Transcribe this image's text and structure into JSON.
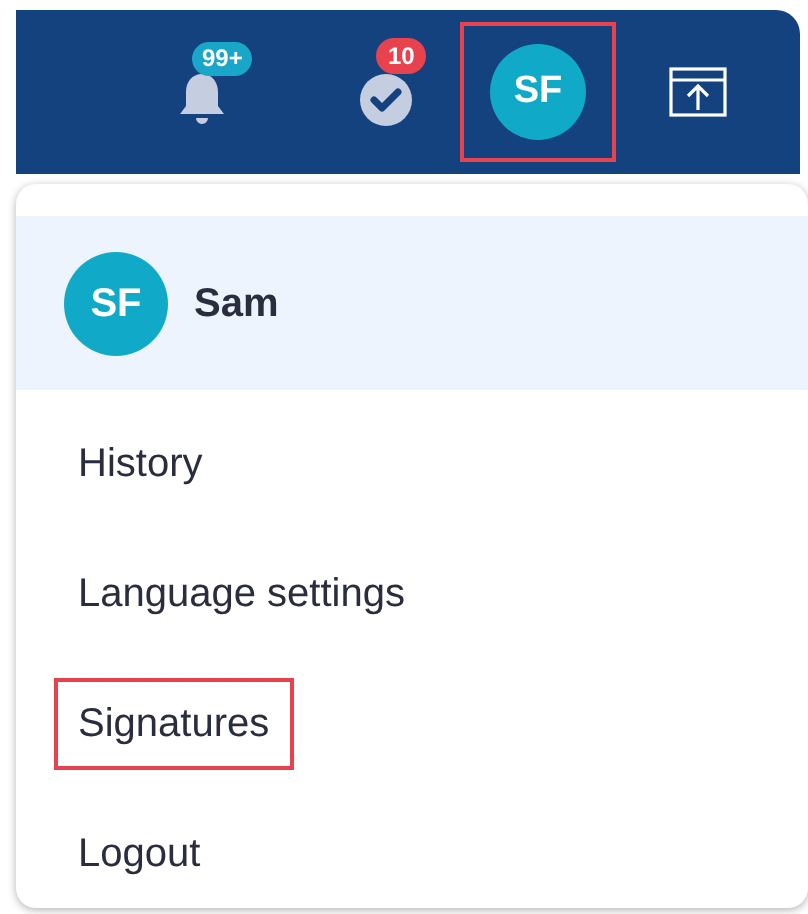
{
  "top_bar": {
    "notifications_badge": "99+",
    "tasks_badge": "10",
    "avatar": {
      "initials": "SF",
      "highlighted": true
    }
  },
  "menu": {
    "user": {
      "initials": "SF",
      "name": "Sam"
    },
    "items": [
      {
        "label": "History",
        "highlighted": false
      },
      {
        "label": "Language settings",
        "highlighted": false
      },
      {
        "label": "Signatures",
        "highlighted": true
      },
      {
        "label": "Logout",
        "highlighted": false
      }
    ]
  }
}
